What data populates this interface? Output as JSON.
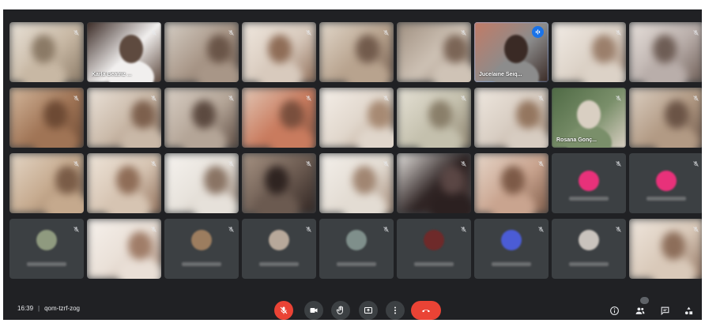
{
  "app": {
    "meeting_time": "16:39",
    "meeting_code": "qom-tzrf-zog"
  },
  "colors": {
    "background": "#202124",
    "tile": "#3c4043",
    "speaking_outline": "#8ab4f8",
    "speaking_badge": "#1a73e8",
    "leave_red": "#ea4335",
    "avatar_pink": "#e8317a",
    "avatar_blue": "#4b5cd6"
  },
  "participants": [
    {
      "row": 0,
      "col": 0,
      "kind": "video",
      "tone": [
        "#c8b8a4",
        "#8b7a66",
        "#e9e2d8"
      ]
    },
    {
      "row": 0,
      "col": 1,
      "kind": "video",
      "label": "Karla Beatriz ...",
      "tone": [
        "#f1efee",
        "#5e4a3f",
        "#3b2b26"
      ]
    },
    {
      "row": 0,
      "col": 2,
      "kind": "video",
      "tone": [
        "#a89687",
        "#6a5548",
        "#d6cfc6"
      ]
    },
    {
      "row": 0,
      "col": 3,
      "kind": "video",
      "tone": [
        "#d8cabd",
        "#8f6d57",
        "#f0e8df"
      ]
    },
    {
      "row": 0,
      "col": 4,
      "kind": "video",
      "tone": [
        "#b8a38e",
        "#725b4c",
        "#e2d8cb"
      ]
    },
    {
      "row": 0,
      "col": 5,
      "kind": "video",
      "tone": [
        "#cfc3b6",
        "#7b6556",
        "#9f8f80"
      ]
    },
    {
      "row": 0,
      "col": 6,
      "kind": "video",
      "label": "Jucelaine Seiq...",
      "speaking": true,
      "tone": [
        "#8c8c8c",
        "#3a2a25",
        "#c27b66"
      ]
    },
    {
      "row": 0,
      "col": 7,
      "kind": "video",
      "tone": [
        "#dcd2c7",
        "#9b7f6b",
        "#f2ece6"
      ]
    },
    {
      "row": 0,
      "col": 8,
      "kind": "video",
      "tone": [
        "#b9aeaa",
        "#6e5d55",
        "#e8e1dc"
      ]
    },
    {
      "row": 1,
      "col": 0,
      "kind": "video",
      "tone": [
        "#a07455",
        "#6d4a34",
        "#d4b89d"
      ]
    },
    {
      "row": 1,
      "col": 1,
      "kind": "video",
      "tone": [
        "#c9b8a7",
        "#7d604d",
        "#ebe3da"
      ]
    },
    {
      "row": 1,
      "col": 2,
      "kind": "video",
      "tone": [
        "#b4a597",
        "#5c4a40",
        "#d9cfc5"
      ]
    },
    {
      "row": 1,
      "col": 3,
      "kind": "video",
      "tone": [
        "#c97b5e",
        "#7a4f3d",
        "#e2c8b7"
      ]
    },
    {
      "row": 1,
      "col": 4,
      "kind": "video",
      "tone": [
        "#e0d6cb",
        "#a78a73",
        "#f5efe9"
      ]
    },
    {
      "row": 1,
      "col": 5,
      "kind": "video",
      "tone": [
        "#c4c0ad",
        "#8a7f6a",
        "#e6e2d6"
      ]
    },
    {
      "row": 1,
      "col": 6,
      "kind": "video",
      "tone": [
        "#d7ccc1",
        "#94765f",
        "#efe8e0"
      ]
    },
    {
      "row": 1,
      "col": 7,
      "kind": "video",
      "label": "Rosana Gonç...",
      "tone": [
        "#7a8f6a",
        "#d9cfc2",
        "#4f6a45"
      ]
    },
    {
      "row": 1,
      "col": 8,
      "kind": "video",
      "tone": [
        "#b29a84",
        "#6b5446",
        "#dcd0c3"
      ]
    },
    {
      "row": 2,
      "col": 0,
      "kind": "video",
      "tone": [
        "#c5a98d",
        "#7a5c47",
        "#e4d6c6"
      ]
    },
    {
      "row": 2,
      "col": 1,
      "kind": "video",
      "tone": [
        "#d6c4b2",
        "#8f6d57",
        "#efe5da"
      ]
    },
    {
      "row": 2,
      "col": 2,
      "kind": "video",
      "tone": [
        "#e6e1da",
        "#8a7464",
        "#f6f3ef"
      ]
    },
    {
      "row": 2,
      "col": 3,
      "kind": "video",
      "tone": [
        "#6b5a50",
        "#2f2421",
        "#a89484"
      ]
    },
    {
      "row": 2,
      "col": 4,
      "kind": "video",
      "tone": [
        "#e3dcd3",
        "#a18672",
        "#f4f0eb"
      ]
    },
    {
      "row": 2,
      "col": 5,
      "kind": "video",
      "tone": [
        "#2b2020",
        "#5a4644",
        "#e9e6e2"
      ]
    },
    {
      "row": 2,
      "col": 6,
      "kind": "video",
      "tone": [
        "#c9a48f",
        "#7d5a47",
        "#e7d7ca"
      ]
    },
    {
      "row": 2,
      "col": 7,
      "kind": "avatar",
      "avatar": "#e8317a"
    },
    {
      "row": 2,
      "col": 8,
      "kind": "avatar",
      "avatar": "#e8317a"
    },
    {
      "row": 3,
      "col": 0,
      "kind": "avatar",
      "avatar": "#8f9a7f"
    },
    {
      "row": 3,
      "col": 1,
      "kind": "video",
      "tone": [
        "#e9dfd6",
        "#a07d68",
        "#f6f1ec"
      ]
    },
    {
      "row": 3,
      "col": 2,
      "kind": "avatar",
      "avatar": "#9c7d5f"
    },
    {
      "row": 3,
      "col": 3,
      "kind": "avatar",
      "avatar": "#b7a89a"
    },
    {
      "row": 3,
      "col": 4,
      "kind": "avatar",
      "avatar": "#7f8f8b"
    },
    {
      "row": 3,
      "col": 5,
      "kind": "avatar",
      "avatar": "#6e2a2a"
    },
    {
      "row": 3,
      "col": 6,
      "kind": "avatar",
      "avatar": "#4b5cd6"
    },
    {
      "row": 3,
      "col": 7,
      "kind": "avatar",
      "avatar": "#c9c3bd"
    },
    {
      "row": 3,
      "col": 8,
      "kind": "video",
      "tone": [
        "#d9c9b9",
        "#8d6e5a",
        "#efe6dd"
      ]
    }
  ],
  "controls": {
    "mic": "mic-off-icon",
    "camera": "camera-icon",
    "raise_hand": "raise-hand-icon",
    "present": "present-icon",
    "more": "more-vertical-icon",
    "leave": "call-end-icon",
    "info": "info-icon",
    "people": "people-icon",
    "chat": "chat-icon",
    "activities": "activities-icon"
  }
}
